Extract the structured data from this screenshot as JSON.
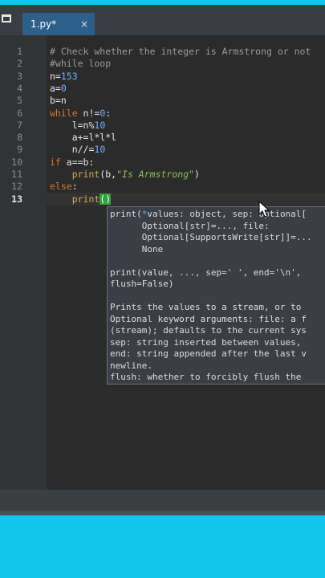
{
  "tab": {
    "name": "1.py*",
    "close": "×"
  },
  "editor": {
    "lines": [
      {
        "num": "1",
        "parts": [
          {
            "cls": "comment",
            "text": "# Check whether the integer is Armstrong or not"
          }
        ]
      },
      {
        "num": "2",
        "parts": [
          {
            "cls": "comment",
            "text": "#while loop"
          }
        ]
      },
      {
        "num": "3",
        "parts": [
          {
            "cls": "",
            "text": "n="
          },
          {
            "cls": "num",
            "text": "153"
          }
        ]
      },
      {
        "num": "4",
        "parts": [
          {
            "cls": "",
            "text": "a="
          },
          {
            "cls": "num",
            "text": "0"
          }
        ]
      },
      {
        "num": "5",
        "parts": [
          {
            "cls": "",
            "text": "b=n"
          }
        ]
      },
      {
        "num": "6",
        "parts": [
          {
            "cls": "kw",
            "text": "while"
          },
          {
            "cls": "",
            "text": " n!="
          },
          {
            "cls": "num",
            "text": "0"
          },
          {
            "cls": "",
            "text": ":"
          }
        ]
      },
      {
        "num": "7",
        "parts": [
          {
            "cls": "",
            "text": "    l=n%"
          },
          {
            "cls": "num",
            "text": "10"
          }
        ]
      },
      {
        "num": "8",
        "parts": [
          {
            "cls": "",
            "text": "    a+=l*l*l"
          }
        ]
      },
      {
        "num": "9",
        "parts": [
          {
            "cls": "",
            "text": "    n//="
          },
          {
            "cls": "num",
            "text": "10"
          }
        ]
      },
      {
        "num": "10",
        "parts": [
          {
            "cls": "kw",
            "text": "if"
          },
          {
            "cls": "",
            "text": " a==b:"
          }
        ]
      },
      {
        "num": "11",
        "parts": [
          {
            "cls": "",
            "text": "    "
          },
          {
            "cls": "builtin",
            "text": "print"
          },
          {
            "cls": "",
            "text": "(b,"
          },
          {
            "cls": "str",
            "text": "\"Is Armstrong\""
          },
          {
            "cls": "",
            "text": ")"
          }
        ]
      },
      {
        "num": "12",
        "parts": [
          {
            "cls": "kw",
            "text": "else"
          },
          {
            "cls": "",
            "text": ":"
          }
        ]
      },
      {
        "num": "13",
        "parts": [
          {
            "cls": "",
            "text": "    "
          },
          {
            "cls": "builtin",
            "text": "print"
          },
          {
            "cls": "caretbox",
            "text": "()"
          }
        ]
      }
    ],
    "active_line": "13"
  },
  "popup": {
    "lines": [
      {
        "parts": [
          {
            "cls": "",
            "text": "print("
          },
          {
            "cls": "phl",
            "text": "*"
          },
          {
            "cls": "",
            "text": "values: object, sep: Optional["
          }
        ]
      },
      {
        "parts": [
          {
            "cls": "",
            "text": "      Optional[str]=..., file:"
          }
        ]
      },
      {
        "parts": [
          {
            "cls": "",
            "text": "      Optional[SupportsWrite[str]]=..."
          }
        ]
      },
      {
        "parts": [
          {
            "cls": "",
            "text": "      None"
          }
        ]
      },
      {
        "parts": [
          {
            "cls": "",
            "text": ""
          }
        ]
      },
      {
        "parts": [
          {
            "cls": "",
            "text": "print(value, ..., sep=' ', end='\\n',"
          }
        ]
      },
      {
        "parts": [
          {
            "cls": "",
            "text": "flush=False)"
          }
        ]
      },
      {
        "parts": [
          {
            "cls": "",
            "text": ""
          }
        ]
      },
      {
        "parts": [
          {
            "cls": "",
            "text": "Prints the values to a stream, or to"
          }
        ]
      },
      {
        "parts": [
          {
            "cls": "",
            "text": "Optional keyword arguments: file: a f"
          }
        ]
      },
      {
        "parts": [
          {
            "cls": "",
            "text": "(stream); defaults to the current sys"
          }
        ]
      },
      {
        "parts": [
          {
            "cls": "",
            "text": "sep: string inserted between values,"
          }
        ]
      },
      {
        "parts": [
          {
            "cls": "",
            "text": "end: string appended after the last v"
          }
        ]
      },
      {
        "parts": [
          {
            "cls": "",
            "text": "newline."
          }
        ]
      },
      {
        "parts": [
          {
            "cls": "",
            "text": "flush: whether to forcibly flush the"
          }
        ]
      }
    ]
  },
  "colors": {
    "accent": "#12c5ea",
    "editor_bg": "#2b2b2b",
    "tab_active": "#2d5f8b"
  }
}
